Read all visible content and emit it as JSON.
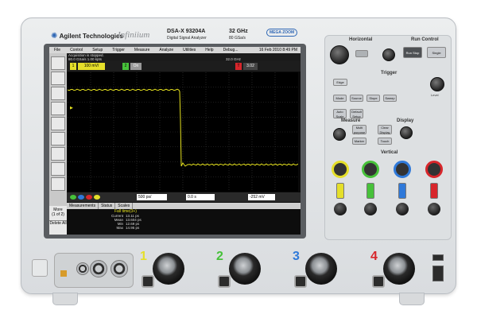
{
  "brand": {
    "name": "Agilent Technologies",
    "series": "Infiniium",
    "model": "DSA-X 93204A",
    "model_sub": "Digital Signal Analyzer",
    "bandwidth": "32 GHz",
    "sample_rate": "80 GSa/s",
    "badge": "MEGA ZOOM"
  },
  "menu": {
    "items": [
      "File",
      "Control",
      "Setup",
      "Trigger",
      "Measure",
      "Analyze",
      "Utilities",
      "Help",
      "Debug..."
    ],
    "date": "16 Feb 2010 8:49 PM"
  },
  "status": {
    "line1": "Acquisition is stopped.",
    "line2": "80.0 GSa/s  1.00 kpts",
    "bandwidth": "32.0 GHz"
  },
  "channels": {
    "ch1_label": "1",
    "ch1_scale": "100 mV/",
    "ch2_label": "2",
    "ch2_state": "On",
    "trig_label": "T",
    "trig_value": "3.02"
  },
  "controls": {
    "timebase": "500 ps/",
    "delay": "0.0 s",
    "trig_level": "-252 mV"
  },
  "more": {
    "label": "More",
    "page": "(1 of 2)",
    "delete": "Delete All"
  },
  "measure_tabs": [
    "Measurements",
    "Status",
    "Scales"
  ],
  "measurement": {
    "name": "Fall time(3+)",
    "rows": [
      {
        "label": "Current",
        "value": "13.11 ps"
      },
      {
        "label": "Mean",
        "value": "13.604 ps"
      },
      {
        "label": "Min",
        "value": "12.69 ps"
      },
      {
        "label": "Max",
        "value": "14.95 ps"
      }
    ]
  },
  "panel": {
    "horizontal": "Horizontal",
    "run_control": "Run Control",
    "run_stop": "Run Stop",
    "single": "Single",
    "trigger": "Trigger",
    "edge": "Edge",
    "mode": "Mode",
    "source": "Source",
    "slope": "Slope",
    "sweep": "Sweep",
    "level": "Level",
    "measure": "Measure",
    "display": "Display",
    "auto_scale": "Auto Scale",
    "default_setup": "Default Setup",
    "position": "Position",
    "multi_purpose": "Multi purpose",
    "clear_display": "Clear Display",
    "marker": "Marker",
    "touch": "Touch",
    "intensity": "Intensity",
    "select": "Select",
    "vertical": "Vertical"
  },
  "inputs": {
    "numbers": [
      "1",
      "2",
      "3",
      "4"
    ]
  },
  "colors": {
    "ch1": "#e5df2a",
    "ch2": "#47c13a",
    "ch3": "#2f79d9",
    "ch4": "#d7262b",
    "trace": "#e6e21f"
  }
}
